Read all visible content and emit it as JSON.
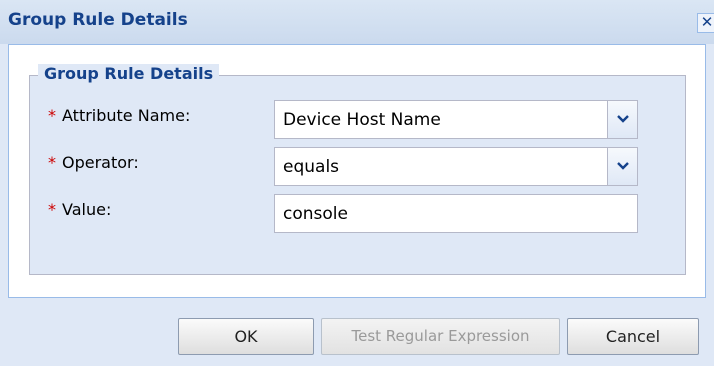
{
  "window": {
    "title": "Group Rule Details",
    "close_glyph": "✕"
  },
  "fieldset": {
    "legend": "Group Rule Details"
  },
  "fields": [
    {
      "required_marker": "*",
      "label": "Attribute Name:",
      "type": "combo",
      "value": "Device Host Name"
    },
    {
      "required_marker": "*",
      "label": "Operator:",
      "type": "combo",
      "value": "equals"
    },
    {
      "required_marker": "*",
      "label": "Value:",
      "type": "text",
      "value": "console"
    }
  ],
  "buttons": {
    "ok": "OK",
    "test_regex": "Test Regular Expression",
    "cancel": "Cancel"
  },
  "colors": {
    "title_text": "#15428b",
    "required": "#cc0000",
    "panel_bg": "#dfe8f6"
  },
  "icons": {
    "combo_trigger": "chevron-down-icon",
    "close": "close-icon"
  }
}
